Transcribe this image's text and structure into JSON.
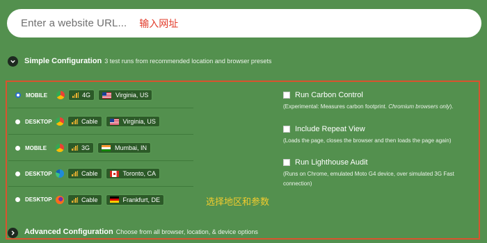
{
  "url_bar": {
    "placeholder": "Enter a website URL...",
    "note": "输入网址"
  },
  "simple": {
    "title": "Simple Configuration",
    "subtitle": "3 test runs from recommended location and browser presets"
  },
  "presets": [
    {
      "device": "MOBILE",
      "browser_icon": "chrome-icon",
      "connection": "4G",
      "flag_icon": "us-flag-icon",
      "location": "Virginia, US",
      "selected": true
    },
    {
      "device": "DESKTOP",
      "browser_icon": "chrome-icon",
      "connection": "Cable",
      "flag_icon": "us-flag-icon",
      "location": "Virginia, US",
      "selected": false
    },
    {
      "device": "MOBILE",
      "browser_icon": "chrome-icon",
      "connection": "3G",
      "flag_icon": "india-flag-icon",
      "location": "Mumbai, IN",
      "selected": false
    },
    {
      "device": "DESKTOP",
      "browser_icon": "edge-icon",
      "connection": "Cable",
      "flag_icon": "canada-flag-icon",
      "location": "Toronto, CA",
      "selected": false
    },
    {
      "device": "DESKTOP",
      "browser_icon": "firefox-icon",
      "connection": "Cable",
      "flag_icon": "germany-flag-icon",
      "location": "Frankfurt, DE",
      "selected": false
    }
  ],
  "options": [
    {
      "label": "Run Carbon Control",
      "desc_plain": "(Experimental: Measures carbon footprint. ",
      "desc_italic": "Chromium browsers only",
      "desc_end": ").",
      "checked": false
    },
    {
      "label": "Include Repeat View",
      "desc": "(Loads the page, closes the browser and then loads the page again)",
      "checked": false
    },
    {
      "label": "Run Lighthouse Audit",
      "desc": "(Runs on Chrome, emulated Moto G4 device, over simulated 3G Fast connection)",
      "checked": false
    }
  ],
  "region_note": "选择地区和参数",
  "advanced": {
    "title": "Advanced Configuration",
    "subtitle": "Choose from all browser, location, & device options"
  },
  "colors": {
    "background": "#53904e",
    "frame": "#d9532e",
    "note_red": "#e23b2a",
    "note_yellow": "#f2cc2e",
    "signal": "#f0b431"
  }
}
